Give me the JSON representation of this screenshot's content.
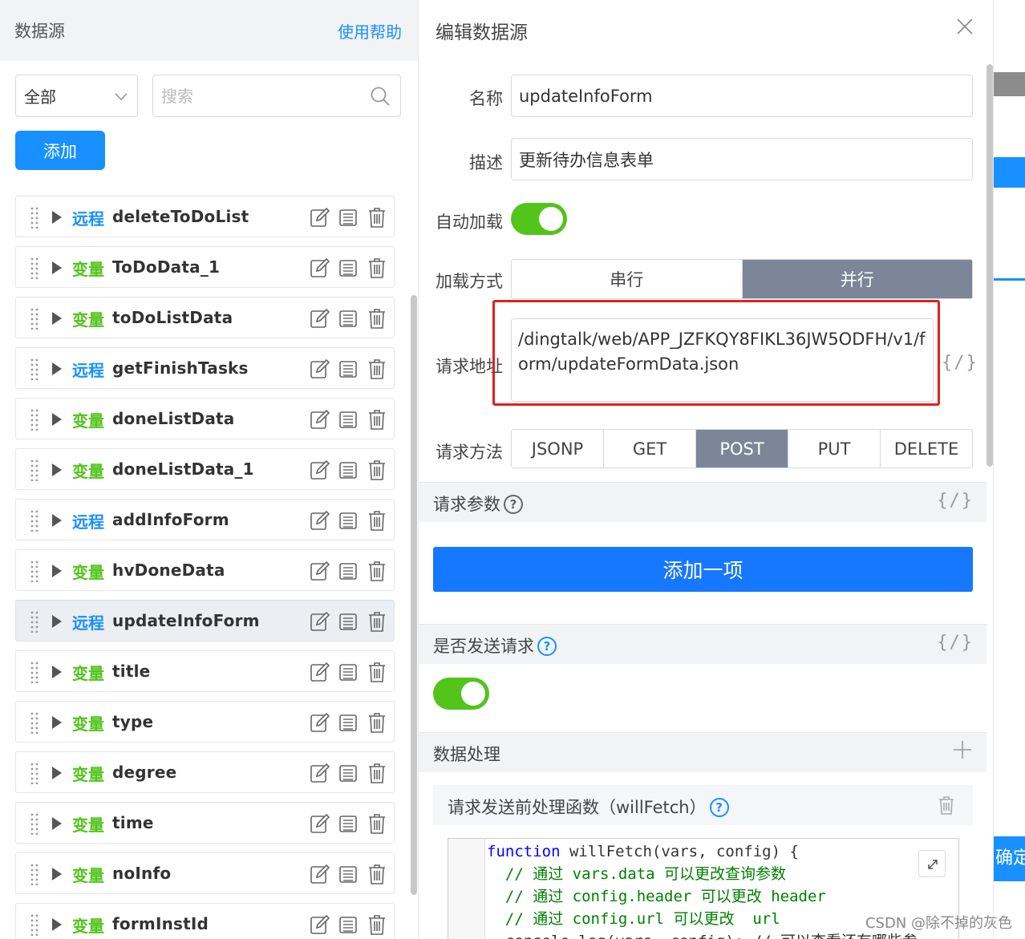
{
  "left": {
    "title": "数据源",
    "help_link": "使用帮助",
    "filter_value": "全部",
    "search_placeholder": "搜索",
    "add_button": "添加",
    "items": [
      {
        "kind": "远程",
        "kind_type": "remote",
        "name": "deleteToDoList",
        "active": false
      },
      {
        "kind": "变量",
        "kind_type": "var",
        "name": "ToDoData_1",
        "active": false
      },
      {
        "kind": "变量",
        "kind_type": "var",
        "name": "toDoListData",
        "active": false
      },
      {
        "kind": "远程",
        "kind_type": "remote",
        "name": "getFinishTasks",
        "active": false
      },
      {
        "kind": "变量",
        "kind_type": "var",
        "name": "doneListData",
        "active": false
      },
      {
        "kind": "变量",
        "kind_type": "var",
        "name": "doneListData_1",
        "active": false
      },
      {
        "kind": "远程",
        "kind_type": "remote",
        "name": "addInfoForm",
        "active": false
      },
      {
        "kind": "变量",
        "kind_type": "var",
        "name": "hvDoneData",
        "active": false
      },
      {
        "kind": "远程",
        "kind_type": "remote",
        "name": "updateInfoForm",
        "active": true
      },
      {
        "kind": "变量",
        "kind_type": "var",
        "name": "title",
        "active": false
      },
      {
        "kind": "变量",
        "kind_type": "var",
        "name": "type",
        "active": false
      },
      {
        "kind": "变量",
        "kind_type": "var",
        "name": "degree",
        "active": false
      },
      {
        "kind": "变量",
        "kind_type": "var",
        "name": "time",
        "active": false
      },
      {
        "kind": "变量",
        "kind_type": "var",
        "name": "noInfo",
        "active": false
      },
      {
        "kind": "变量",
        "kind_type": "var",
        "name": "formInstId",
        "active": false
      }
    ]
  },
  "editor": {
    "title": "编辑数据源",
    "name_label": "名称",
    "name_value": "updateInfoForm",
    "desc_label": "描述",
    "desc_value": "更新待办信息表单",
    "autoload_label": "自动加载",
    "autoload_on": true,
    "loadmode_label": "加载方式",
    "loadmode_options": [
      "串行",
      "并行"
    ],
    "loadmode_selected": "并行",
    "url_label": "请求地址",
    "url_value": "/dingtalk/web/APP_JZFKQY8FIKL36JW5ODFH/v1/form/updateFormData.json",
    "code_toggle": "{/}",
    "method_label": "请求方法",
    "method_options": [
      "JSONP",
      "GET",
      "POST",
      "PUT",
      "DELETE"
    ],
    "method_selected": "POST",
    "params_label": "请求参数",
    "add_item_button": "添加一项",
    "send_label": "是否发送请求",
    "send_on": true,
    "data_processing_label": "数据处理",
    "willfetch_label": "请求发送前处理函数（willFetch）",
    "code_lines": [
      "function willFetch(vars, config) {",
      "  // 通过 vars.data 可以更改查询参数",
      "  // 通过 config.header 可以更改 header",
      "  // 通过 config.url 可以更改  url",
      "  console.log(vars, config); // 可以查看还有哪些参"
    ]
  },
  "strip": {
    "confirm_label": "确定"
  },
  "watermark": "CSDN @除不掉的灰色",
  "colors": {
    "primary": "#1890ff",
    "remote_kind": "#1890ff",
    "var_kind": "#52c41a",
    "toggle_on": "#52c41a",
    "segment_selected": "#7b8799",
    "highlight_frame": "#e02020"
  },
  "icons": {
    "item_actions": [
      "edit-icon",
      "copy-icon",
      "trash-icon"
    ],
    "drag": "drag-handle-icon",
    "expand": "triangle-right-icon",
    "search": "search-icon",
    "select": "chevron-down-icon",
    "close": "close-icon",
    "help": "question-circle-icon",
    "plus": "plus-icon",
    "fullscreen": "expand-icon"
  }
}
